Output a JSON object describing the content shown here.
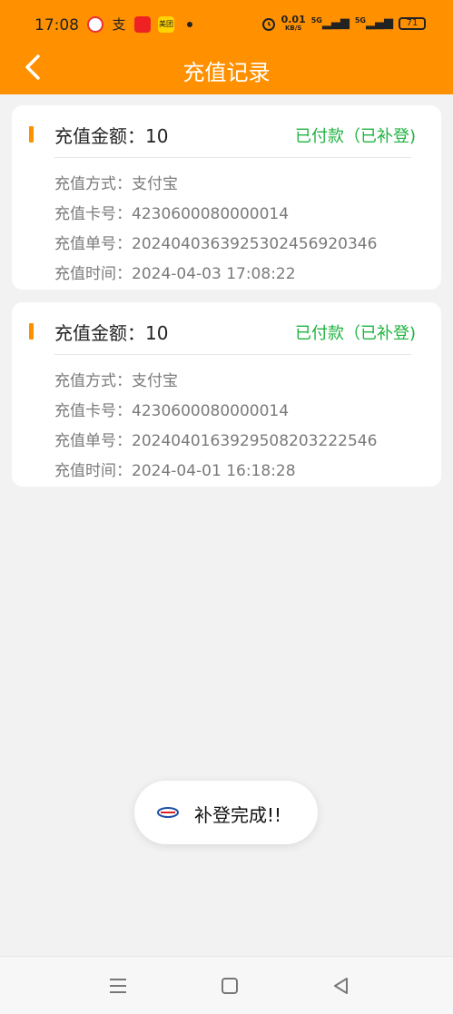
{
  "status_bar": {
    "time": "17:08",
    "net_speed_value": "0.01",
    "net_speed_unit": "KB/S",
    "signal_1": "5G",
    "signal_2": "5G",
    "battery": "71"
  },
  "header": {
    "title": "充值记录",
    "back_icon": "back-arrow-icon"
  },
  "records": [
    {
      "amount_label": "充值金额：",
      "amount": "10",
      "status": "已付款（已补登)",
      "method_label": "充值方式：",
      "method": "支付宝",
      "card_label": "充值卡号：",
      "card": "4230600080000014",
      "order_label": "充值单号：",
      "order": "20240403639253024569 20346",
      "time_label": "充值时间：",
      "time": "2024-04-03 17:08:22"
    },
    {
      "amount_label": "充值金额：",
      "amount": "10",
      "status": "已付款（已补登)",
      "method_label": "充值方式：",
      "method": "支付宝",
      "card_label": "充值卡号：",
      "card": "4230600080000014",
      "order_label": "充值单号：",
      "order": "20240401639295082032 22546",
      "time_label": "充值时间：",
      "time": "2024-04-01 16:18:28"
    }
  ],
  "toast": {
    "message": "补登完成!!"
  },
  "nav": {
    "menu_icon": "menu-icon",
    "home_icon": "home-square-icon",
    "back_icon": "back-triangle-icon"
  },
  "colors": {
    "brand": "#ff9000",
    "success": "#1fb33f"
  }
}
